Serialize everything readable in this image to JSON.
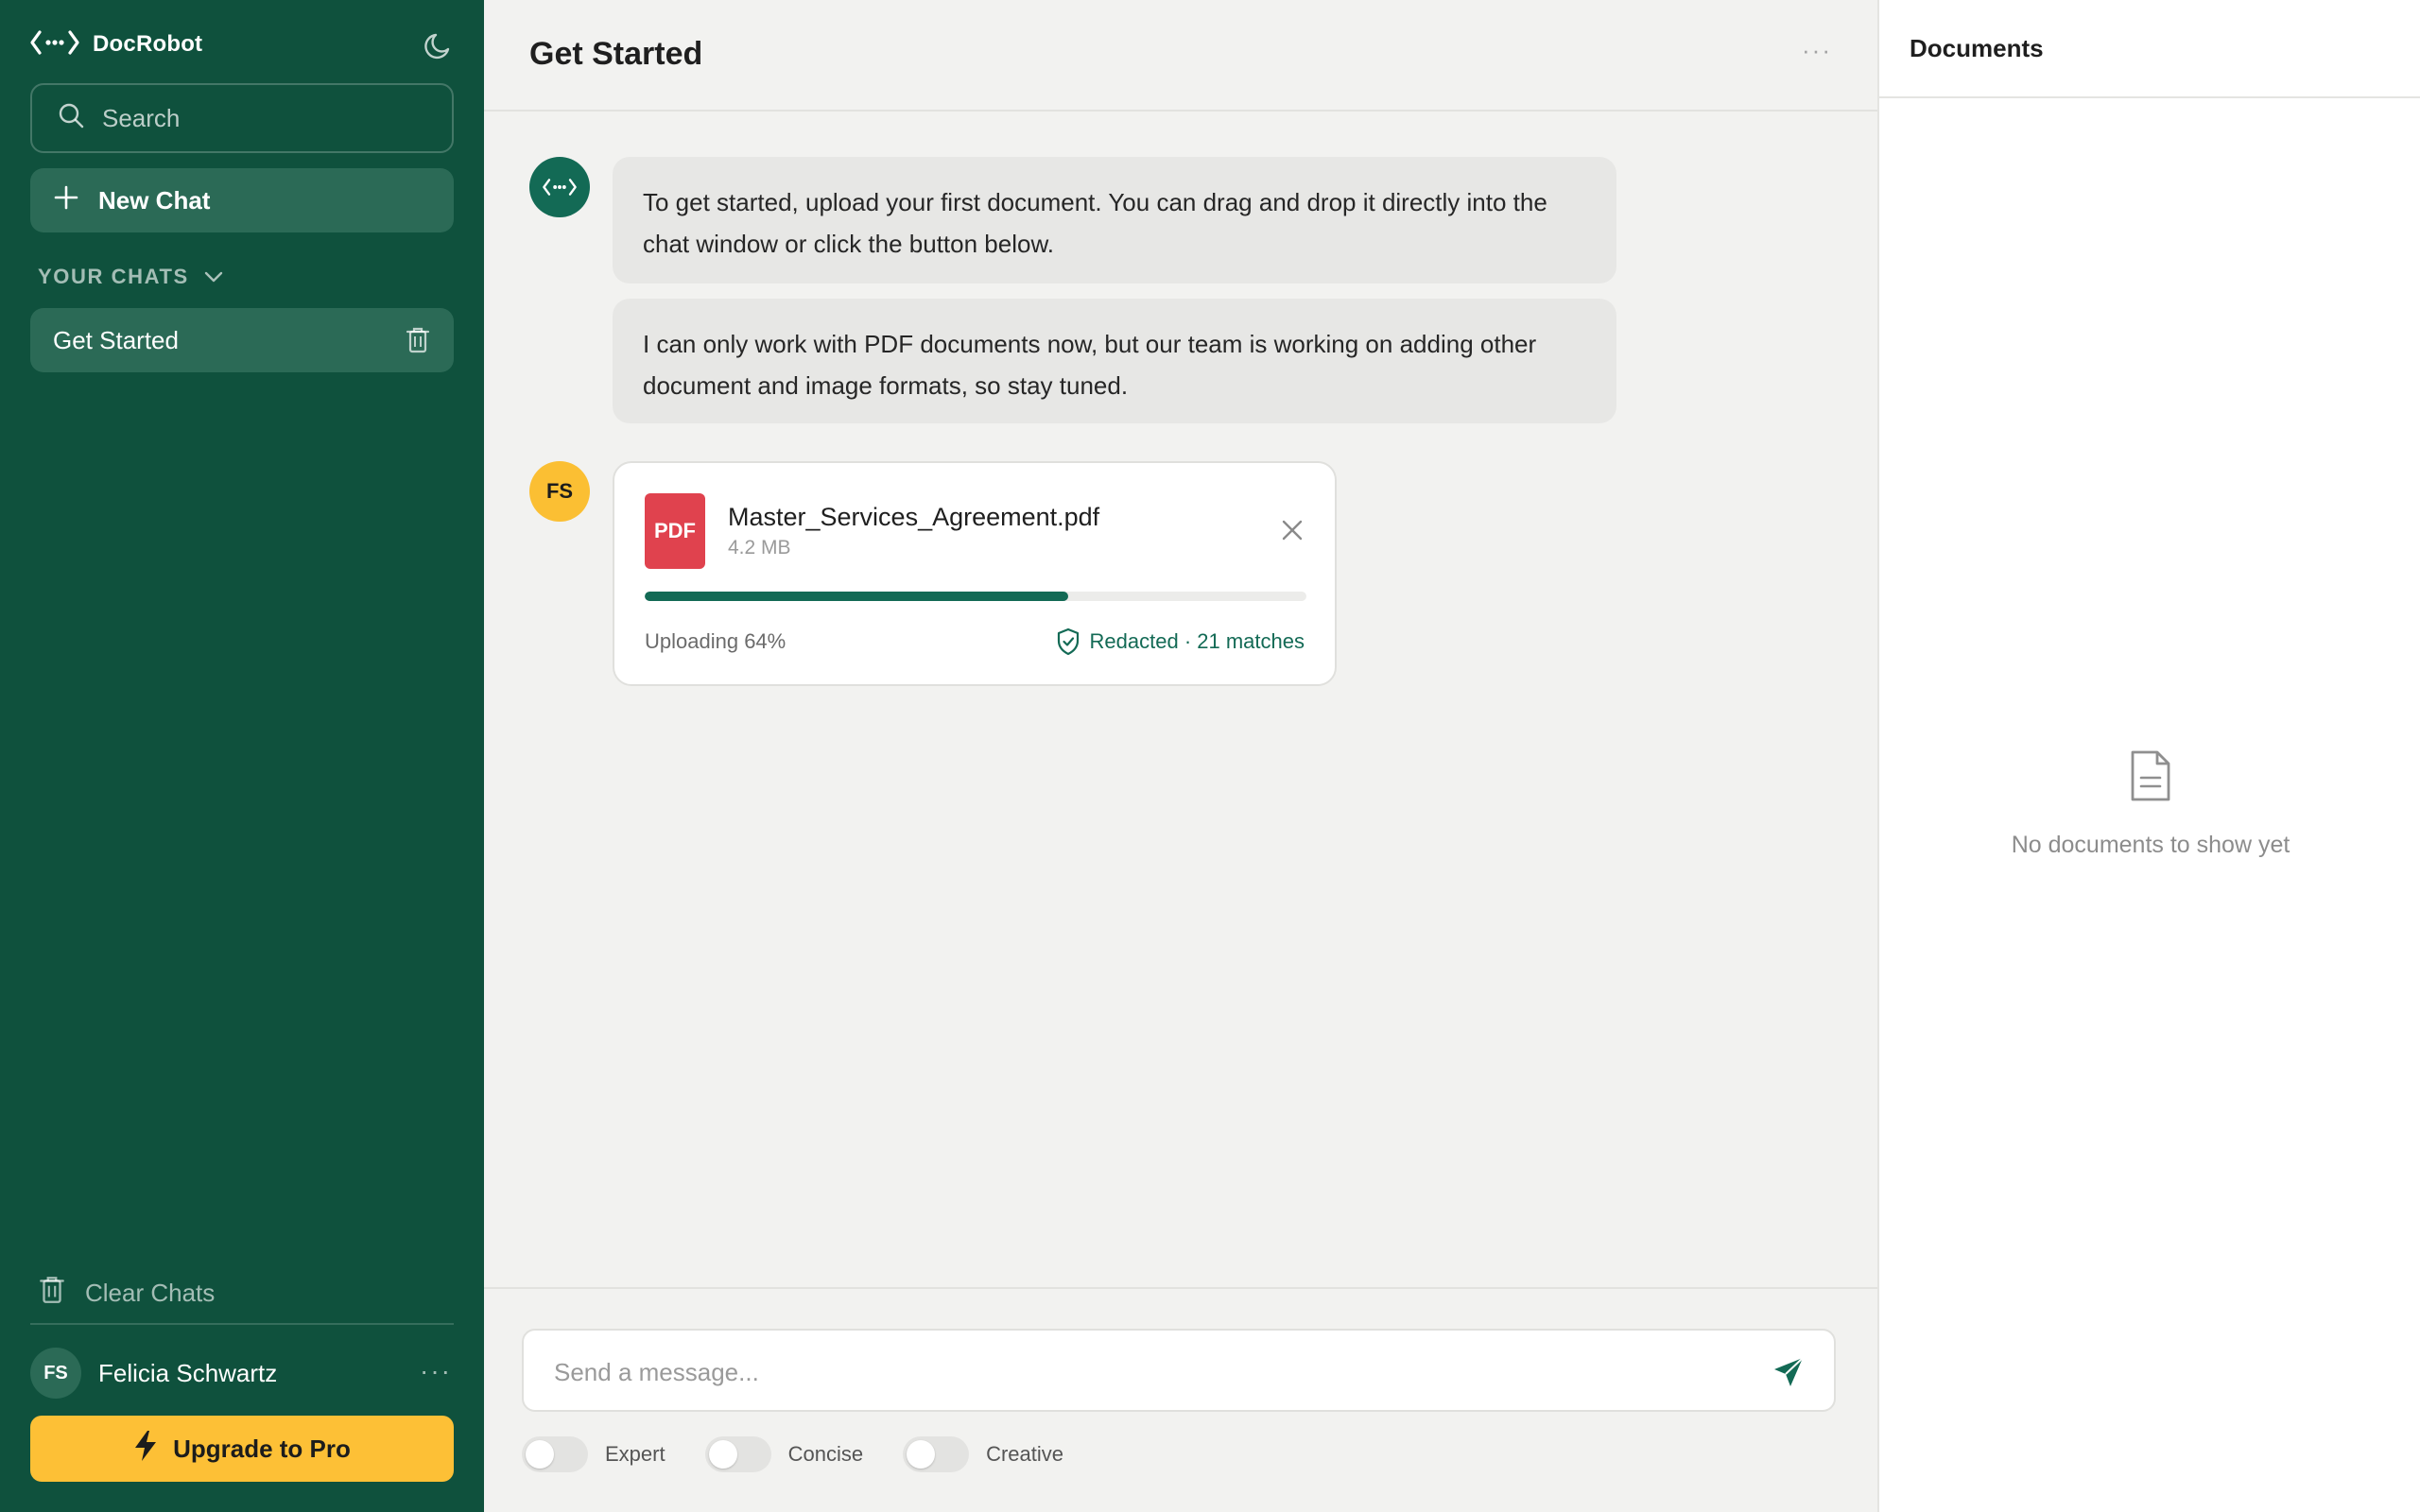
{
  "sidebar": {
    "brand": "DocRobot",
    "search_placeholder": "Search",
    "new_chat_label": "New Chat",
    "section_label": "YOUR CHATS",
    "chats": [
      {
        "label": "Get Started"
      }
    ],
    "clear_chats_label": "Clear Chats",
    "user": {
      "initials": "FS",
      "name": "Felicia Schwartz"
    },
    "upgrade_label": "Upgrade to Pro"
  },
  "main": {
    "title": "Get Started",
    "messages": [
      {
        "text": "To get started, upload your first document. You can drag and drop it directly into the chat window or click the button below."
      },
      {
        "text": "I can only work with PDF documents now, but our team is working on adding other document and image formats, so stay tuned."
      }
    ],
    "user_initials": "FS",
    "upload": {
      "badge": "PDF",
      "filename": "Master_Services_Agreement.pdf",
      "size": "4.2 MB",
      "progress": 0.64,
      "status": "Uploading 64%",
      "redacted": "Redacted · 21 matches"
    },
    "composer": {
      "placeholder": "Send a message..."
    },
    "toggles": [
      {
        "label": "Expert",
        "on": false
      },
      {
        "label": "Concise",
        "on": false
      },
      {
        "label": "Creative",
        "on": false
      }
    ]
  },
  "documents": {
    "title": "Documents",
    "empty_text": "No documents to show yet"
  },
  "colors": {
    "sidebar_bg": "#0f513d",
    "accent": "#136a55",
    "upgrade": "#fdc036",
    "pdf": "#e0424e",
    "user_avatar": "#fbbf33"
  },
  "icons": [
    "logo-icon",
    "moon-icon",
    "search-icon",
    "plus-icon",
    "chevron-down-icon",
    "trash-icon",
    "more-icon",
    "bolt-icon",
    "close-icon",
    "shield-check-icon",
    "send-icon",
    "document-icon"
  ]
}
